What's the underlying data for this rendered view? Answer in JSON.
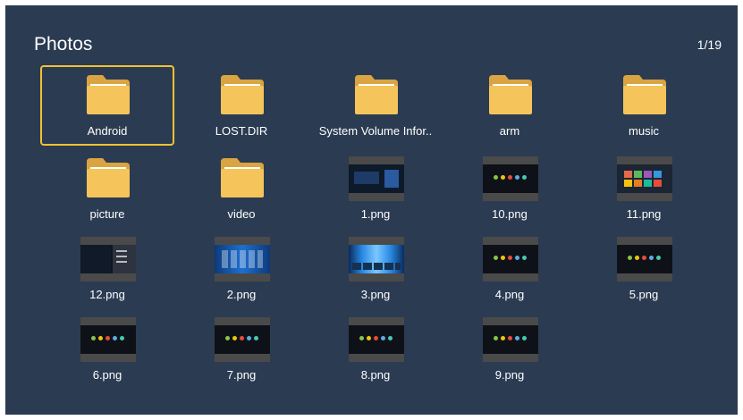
{
  "header": {
    "title": "Photos",
    "page_indicator": "1/19"
  },
  "accent_color": "#f2c230",
  "items": [
    {
      "label": "Android",
      "type": "folder",
      "selected": true
    },
    {
      "label": "LOST.DIR",
      "type": "folder"
    },
    {
      "label": "System Volume Infor..",
      "type": "folder"
    },
    {
      "label": "arm",
      "type": "folder"
    },
    {
      "label": "music",
      "type": "folder"
    },
    {
      "label": "picture",
      "type": "folder"
    },
    {
      "label": "video",
      "type": "folder"
    },
    {
      "label": "1.png",
      "type": "image",
      "thumb": "dark-screen"
    },
    {
      "label": "10.png",
      "type": "image",
      "thumb": "icon-row"
    },
    {
      "label": "11.png",
      "type": "image",
      "thumb": "tiles"
    },
    {
      "label": "12.png",
      "type": "image",
      "thumb": "dark-menu"
    },
    {
      "label": "2.png",
      "type": "image",
      "thumb": "blue-grid"
    },
    {
      "label": "3.png",
      "type": "image",
      "thumb": "blue-stage"
    },
    {
      "label": "4.png",
      "type": "image",
      "thumb": "icon-row"
    },
    {
      "label": "5.png",
      "type": "image",
      "thumb": "icon-row"
    },
    {
      "label": "6.png",
      "type": "image",
      "thumb": "icon-row"
    },
    {
      "label": "7.png",
      "type": "image",
      "thumb": "icon-row"
    },
    {
      "label": "8.png",
      "type": "image",
      "thumb": "icon-row"
    },
    {
      "label": "9.png",
      "type": "image",
      "thumb": "icon-row"
    }
  ]
}
